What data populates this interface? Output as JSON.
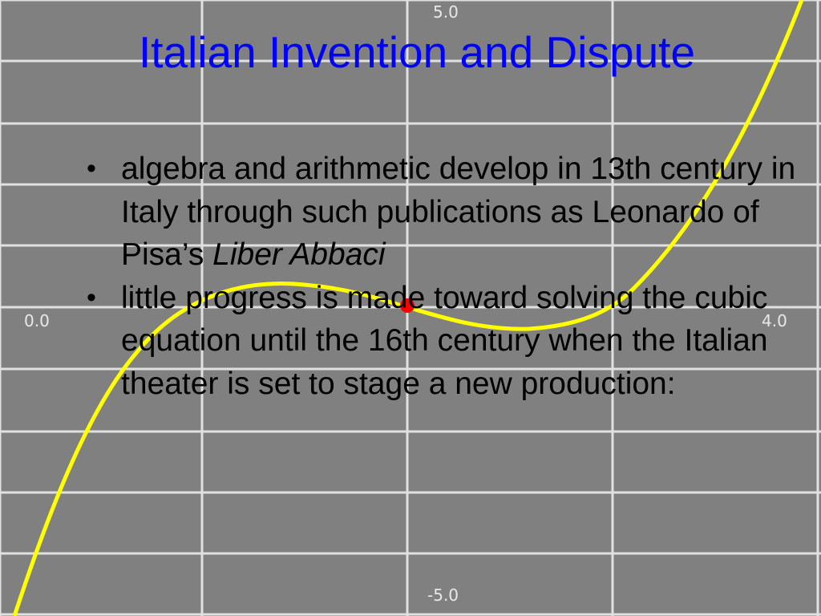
{
  "slide": {
    "title": "Italian Invention and Dispute",
    "bullets": [
      {
        "text": "algebra and arithmetic develop in 13th century in Italy through such publications as Leonardo of Pisa’s ",
        "italic_tail": "Liber Abbaci"
      },
      {
        "text": "little progress is made toward solving the cubic equation until the 16th century when the Italian theater is set to stage a new production:",
        "italic_tail": ""
      }
    ],
    "bullet_glyph": "•"
  },
  "background_plot": {
    "labels": {
      "top": "5.0",
      "bottom": "-5.0",
      "left": "0.0",
      "right": "4.0"
    },
    "colors": {
      "background": "#808080",
      "grid": "#e0e0e0",
      "curve": "#ffff00",
      "point": "#ff0000"
    },
    "curve_type": "cubic"
  }
}
